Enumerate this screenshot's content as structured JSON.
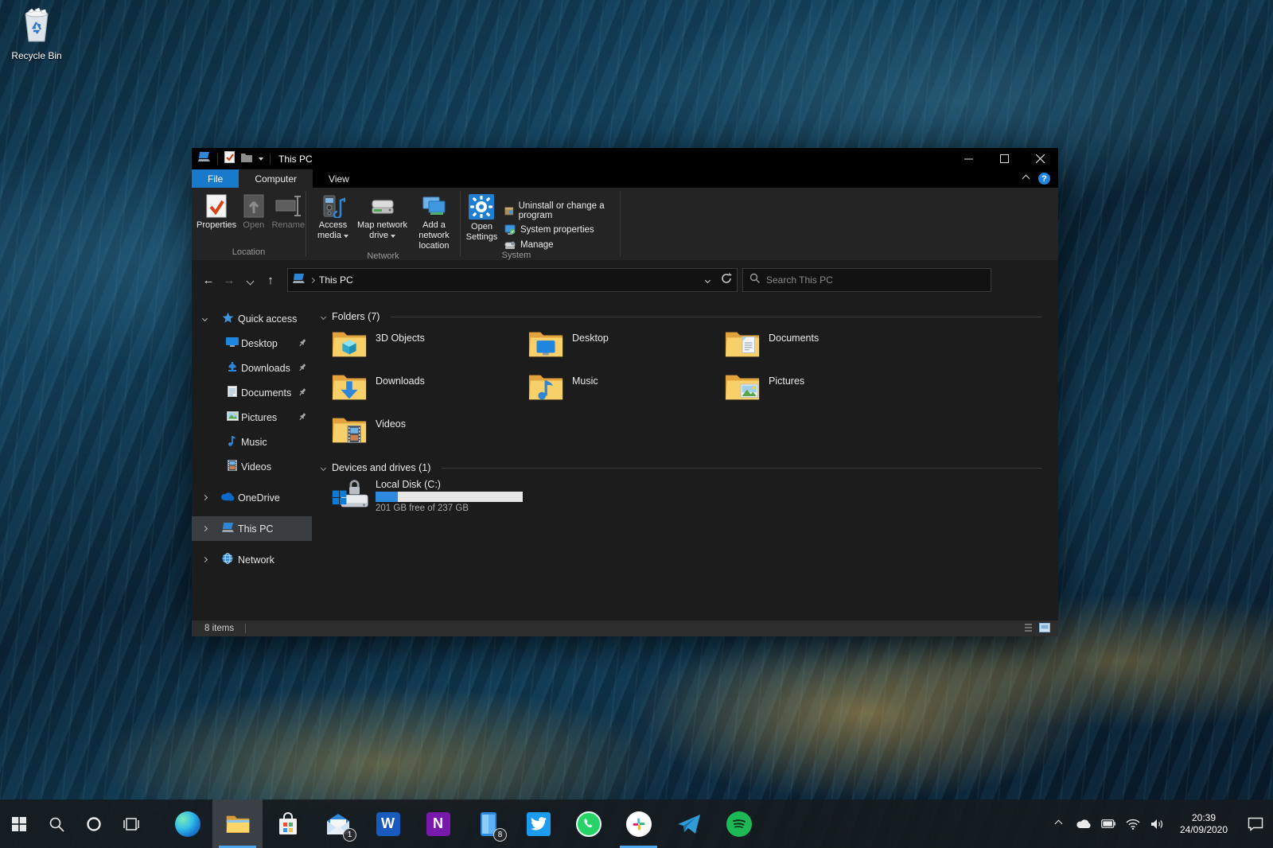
{
  "desktop": {
    "recycle_bin_label": "Recycle Bin"
  },
  "window": {
    "title": "This PC",
    "tabs": {
      "file": "File",
      "computer": "Computer",
      "view": "View"
    }
  },
  "ribbon": {
    "location": {
      "label": "Location",
      "properties": "Properties",
      "open": "Open",
      "rename": "Rename"
    },
    "network": {
      "label": "Network",
      "access_media": "Access media",
      "map_drive": "Map network drive",
      "add_location": "Add a network location"
    },
    "system": {
      "label": "System",
      "open_settings": "Open Settings",
      "items": [
        {
          "label": "Uninstall or change a program"
        },
        {
          "label": "System properties"
        },
        {
          "label": "Manage"
        }
      ]
    }
  },
  "navbar": {
    "breadcrumb": "This PC",
    "search_placeholder": "Search This PC"
  },
  "sidebar": {
    "items": [
      {
        "label": "Quick access"
      },
      {
        "label": "Desktop"
      },
      {
        "label": "Downloads"
      },
      {
        "label": "Documents"
      },
      {
        "label": "Pictures"
      },
      {
        "label": "Music"
      },
      {
        "label": "Videos"
      },
      {
        "label": "OneDrive"
      },
      {
        "label": "This PC"
      },
      {
        "label": "Network"
      }
    ]
  },
  "content": {
    "folders": {
      "title": "Folders (7)",
      "tiles": [
        {
          "name": "3D Objects"
        },
        {
          "name": "Desktop"
        },
        {
          "name": "Documents"
        },
        {
          "name": "Downloads"
        },
        {
          "name": "Music"
        },
        {
          "name": "Pictures"
        },
        {
          "name": "Videos"
        }
      ]
    },
    "drives": {
      "title": "Devices and drives (1)",
      "drive": {
        "name": "Local Disk (C:)",
        "free_text": "201 GB free of 237 GB",
        "used_percent": 15
      }
    }
  },
  "statusbar": {
    "count": "8 items"
  },
  "taskbar": {
    "badges": {
      "mail": "1",
      "your_phone": "8"
    },
    "tray": {
      "time": "20:39",
      "date": "24/09/2020"
    }
  },
  "colors": {
    "accent": "#0078d7",
    "file_tab": "#1979ca",
    "folder_front": "#f7d069",
    "folder_back": "#e2a23c",
    "drive_fill": "#2d8ae0"
  }
}
